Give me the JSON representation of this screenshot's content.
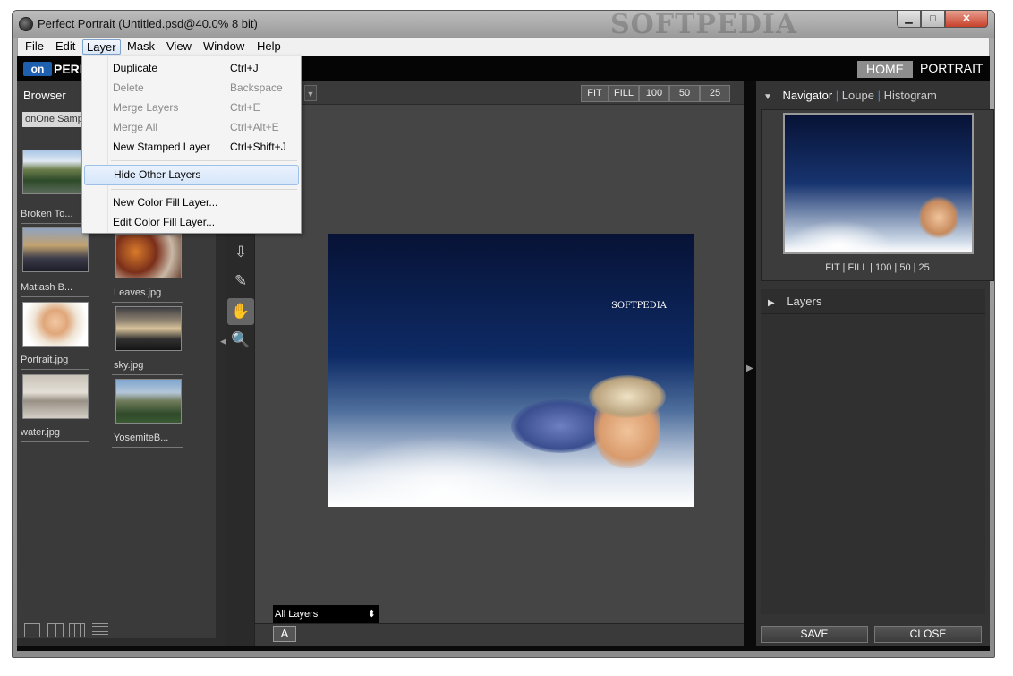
{
  "window": {
    "title": "Perfect Portrait (Untitled.psd@40.0% 8 bit)",
    "watermark": "SOFTPEDIA",
    "min_glyph": "▁",
    "max_glyph": "□",
    "close_glyph": "✕"
  },
  "menubar": [
    "File",
    "Edit",
    "Layer",
    "Mask",
    "View",
    "Window",
    "Help"
  ],
  "layer_menu": {
    "items": [
      {
        "label": "Duplicate",
        "shortcut": "Ctrl+J",
        "enabled": true
      },
      {
        "label": "Delete",
        "shortcut": "Backspace",
        "enabled": false
      },
      {
        "label": "Merge Layers",
        "shortcut": "Ctrl+E",
        "enabled": false
      },
      {
        "label": "Merge All",
        "shortcut": "Ctrl+Alt+E",
        "enabled": false
      },
      {
        "label": "New Stamped Layer",
        "shortcut": "Ctrl+Shift+J",
        "enabled": true
      },
      {
        "label": "Hide Other Layers",
        "shortcut": "",
        "enabled": true,
        "highlighted": true
      },
      {
        "label": "New Color Fill Layer...",
        "shortcut": "",
        "enabled": true
      },
      {
        "label": "Edit Color Fill Layer...",
        "shortcut": "",
        "enabled": true
      }
    ]
  },
  "header": {
    "logo": "on",
    "brand": "PERI",
    "home": "HOME",
    "portrait": "PORTRAIT"
  },
  "browser": {
    "tab": "Browser",
    "sep": "|",
    "path": "onOne Samp",
    "files": [
      {
        "name": "Broken To..."
      },
      {
        "name": "Matiash B..."
      },
      {
        "name": "Leaves.jpg"
      },
      {
        "name": "Portrait.jpg"
      },
      {
        "name": "sky.jpg"
      },
      {
        "name": "water.jpg"
      },
      {
        "name": "YosemiteB..."
      }
    ]
  },
  "canvas": {
    "zoom": [
      "FIT",
      "FILL",
      "100",
      "50",
      "25"
    ],
    "dropdown_arrow": "▼",
    "layer_select": "All Layers",
    "layer_select_arrow": "⬍",
    "a_button": "A",
    "image_text": "SOFTPEDIA"
  },
  "tools": {
    "pin": "⇩",
    "brush": "✎",
    "hand": "✋",
    "zoom": "🔍"
  },
  "right": {
    "nav_arrow": "▼",
    "nav_tabs": [
      "Navigator",
      "Loupe",
      "Histogram"
    ],
    "nav_zoom": "FIT | FILL | 100 | 50 | 25",
    "layers_arrow": "▶",
    "layers": "Layers",
    "save": "SAVE",
    "close": "CLOSE"
  },
  "splitters": {
    "left": "◀",
    "right": "▶"
  }
}
